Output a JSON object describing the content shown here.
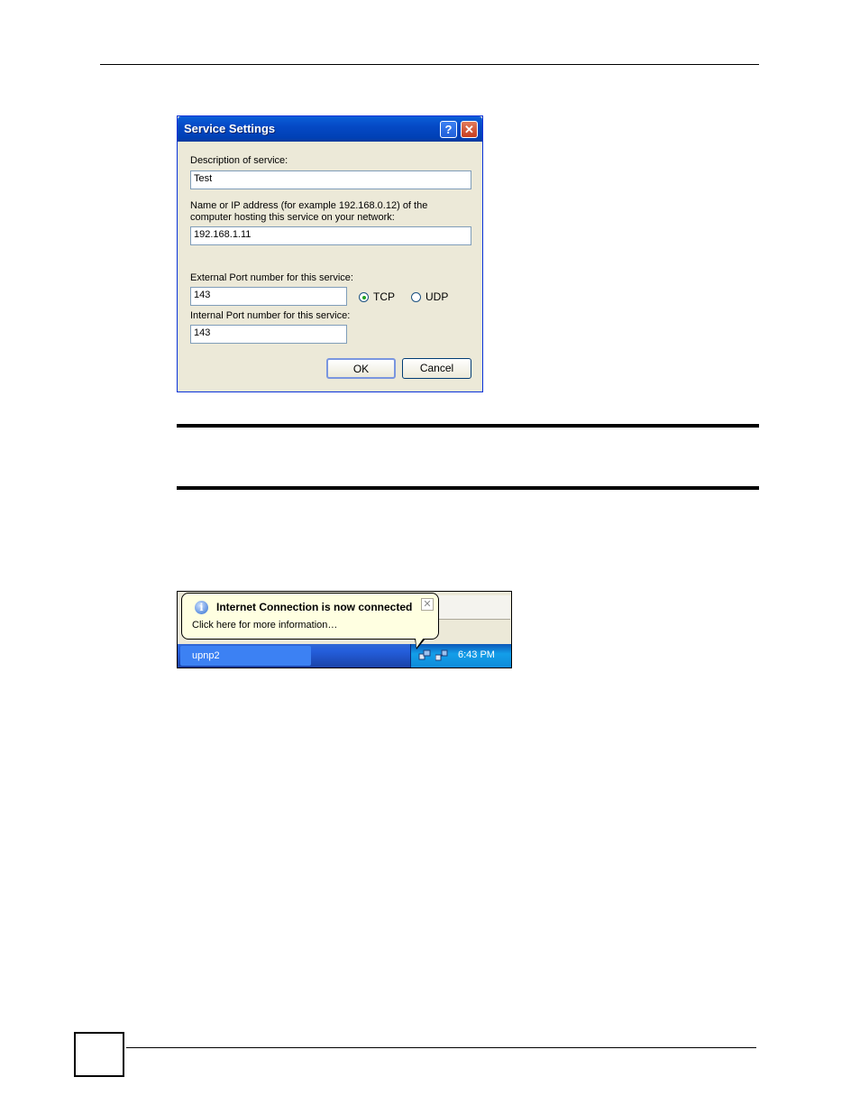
{
  "dialog": {
    "title": "Service Settings",
    "help_glyph": "?",
    "close_glyph": "✕",
    "description_label": "Description of service:",
    "description_value": "Test",
    "host_label_line1": "Name or IP address (for example 192.168.0.12) of the",
    "host_label_line2": "computer hosting this service on your network:",
    "host_value": "192.168.1.11",
    "external_port_label": "External Port number for this service:",
    "external_port_value": "143",
    "internal_port_label": "Internal Port number for this service:",
    "internal_port_value": "143",
    "protocol_options": [
      "TCP",
      "UDP"
    ],
    "protocol_selected": "TCP",
    "ok_label": "OK",
    "cancel_label": "Cancel"
  },
  "notification": {
    "title": "Internet Connection is now connected",
    "text": "Click here for more information…",
    "close_glyph": "✕",
    "info_glyph": "i"
  },
  "taskbar": {
    "task_label": "upnp2",
    "clock": "6:43 PM"
  },
  "colors": {
    "titlebar": "#0549c5",
    "dialog_bg": "#ece9d8",
    "balloon_bg": "#ffffe1",
    "taskbar": "#245edb"
  }
}
